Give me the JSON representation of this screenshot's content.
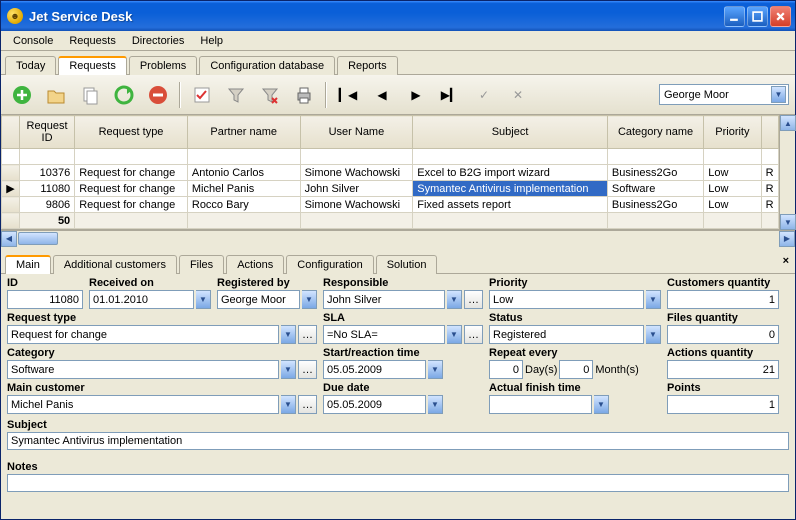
{
  "window": {
    "title": "Jet Service Desk"
  },
  "menu": [
    "Console",
    "Requests",
    "Directories",
    "Help"
  ],
  "main_tabs": [
    "Today",
    "Requests",
    "Problems",
    "Configuration database",
    "Reports"
  ],
  "main_tab_active": 1,
  "toolbar_user": "George Moor",
  "grid": {
    "columns": [
      "Request ID",
      "Request type",
      "Partner name",
      "User Name",
      "Subject",
      "Category name",
      "Priority",
      ""
    ],
    "rows": [
      {
        "id": "10376",
        "type": "Request for change",
        "partner": "Antonio Carlos",
        "user": "Simone Wachowski",
        "subject": "Excel to B2G import wizard",
        "category": "Business2Go",
        "priority": "Low",
        "r": "R"
      },
      {
        "id": "11080",
        "type": "Request for change",
        "partner": "Michel Panis",
        "user": "John Silver",
        "subject": "Symantec Antivirus implementation",
        "category": "Software",
        "priority": "Low",
        "r": "R"
      },
      {
        "id": "9806",
        "type": "Request for change",
        "partner": "Rocco Bary",
        "user": "Simone Wachowski",
        "subject": "Fixed assets report",
        "category": "Business2Go",
        "priority": "Low",
        "r": "R"
      }
    ],
    "selected": 1,
    "footer_count": "50"
  },
  "detail_tabs": [
    "Main",
    "Additional customers",
    "Files",
    "Actions",
    "Configuration",
    "Solution"
  ],
  "detail_tab_active": 0,
  "form": {
    "id_label": "ID",
    "id": "11080",
    "received_label": "Received on",
    "received": "01.01.2010",
    "registered_label": "Registered by",
    "registered": "George Moor",
    "responsible_label": "Responsible",
    "responsible": "John Silver",
    "priority_label": "Priority",
    "priority": "Low",
    "cust_qty_label": "Customers quantity",
    "cust_qty": "1",
    "reqtype_label": "Request type",
    "reqtype": "Request for change",
    "sla_label": "SLA",
    "sla": "=No SLA=",
    "status_label": "Status",
    "status": "Registered",
    "files_qty_label": "Files quantity",
    "files_qty": "0",
    "category_label": "Category",
    "category": "Software",
    "start_label": "Start/reaction time",
    "start": "05.05.2009",
    "repeat_label": "Repeat every",
    "repeat_days": "0",
    "repeat_days_unit": "Day(s)",
    "repeat_months": "0",
    "repeat_months_unit": "Month(s)",
    "actions_qty_label": "Actions quantity",
    "actions_qty": "21",
    "maincust_label": "Main customer",
    "maincust": "Michel Panis",
    "due_label": "Due date",
    "due": "05.05.2009",
    "actual_label": "Actual finish time",
    "actual": "",
    "points_label": "Points",
    "points": "1",
    "subject_label": "Subject",
    "subject": "Symantec Antivirus implementation",
    "notes_label": "Notes",
    "notes": ""
  }
}
